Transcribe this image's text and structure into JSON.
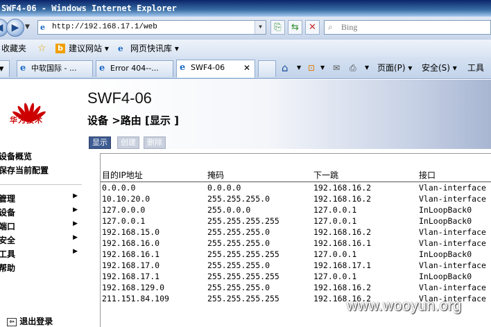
{
  "window": {
    "title": "SWF4-06 - Windows Internet Explorer"
  },
  "addressbar": {
    "url": "http://192.168.17.1/web",
    "search_placeholder": "Bing"
  },
  "favorites_bar": {
    "favorites_label": "收藏夹",
    "suggested_sites": "建议网站 ▾",
    "web_slice": "网页快讯库 ▾"
  },
  "tabs": [
    {
      "label": "中软国际 - ..."
    },
    {
      "label": "Error 404--..."
    },
    {
      "label": "SWF4-06"
    }
  ],
  "command_bar": {
    "page_label": "页面(P) ▾",
    "safety_label": "安全(S) ▾",
    "tools_label": "工具"
  },
  "logo": {
    "text": "华为技术"
  },
  "sidebar": {
    "top_links": [
      {
        "label": "设备概览"
      },
      {
        "label": "保存当前配置"
      }
    ],
    "menus": [
      {
        "label": "管理"
      },
      {
        "label": "设备"
      },
      {
        "label": "端口"
      },
      {
        "label": "安全"
      },
      {
        "label": "工具"
      },
      {
        "label": "帮助"
      }
    ],
    "logout_label": "退出登录"
  },
  "header": {
    "device_name": "SWF4-06",
    "breadcrumb": "设备 >路由 [显示 ]"
  },
  "page_tabs": [
    {
      "label": "显示",
      "active": true
    },
    {
      "label": "创建",
      "active": false
    },
    {
      "label": "删除",
      "active": false
    }
  ],
  "route_table": {
    "columns": [
      "目的IP地址",
      "掩码",
      "下一跳",
      "接口"
    ],
    "rows": [
      [
        "0.0.0.0",
        "0.0.0.0",
        "192.168.16.2",
        "Vlan-interface"
      ],
      [
        "10.10.20.0",
        "255.255.255.0",
        "192.168.16.2",
        "Vlan-interface"
      ],
      [
        "127.0.0.0",
        "255.0.0.0",
        "127.0.0.1",
        "InLoopBack0"
      ],
      [
        "127.0.0.1",
        "255.255.255.255",
        "127.0.0.1",
        "InLoopBack0"
      ],
      [
        "192.168.15.0",
        "255.255.255.0",
        "192.168.16.2",
        "Vlan-interface"
      ],
      [
        "192.168.16.0",
        "255.255.255.0",
        "192.168.16.1",
        "Vlan-interface"
      ],
      [
        "192.168.16.1",
        "255.255.255.255",
        "127.0.0.1",
        "InLoopBack0"
      ],
      [
        "192.168.17.0",
        "255.255.255.0",
        "192.168.17.1",
        "Vlan-interface"
      ],
      [
        "192.168.17.1",
        "255.255.255.255",
        "127.0.0.1",
        "InLoopBack0"
      ],
      [
        "192.168.129.0",
        "255.255.255.0",
        "192.168.16.2",
        "Vlan-interface"
      ],
      [
        "211.151.84.109",
        "255.255.255.255",
        "192.168.16.2",
        "Vlan-interface"
      ]
    ]
  },
  "watermark": "www.wooyun.org",
  "colors": {
    "titlebar": "#0a246a",
    "active_tab": "#3e5b92",
    "logo_red": "#cc0000"
  }
}
